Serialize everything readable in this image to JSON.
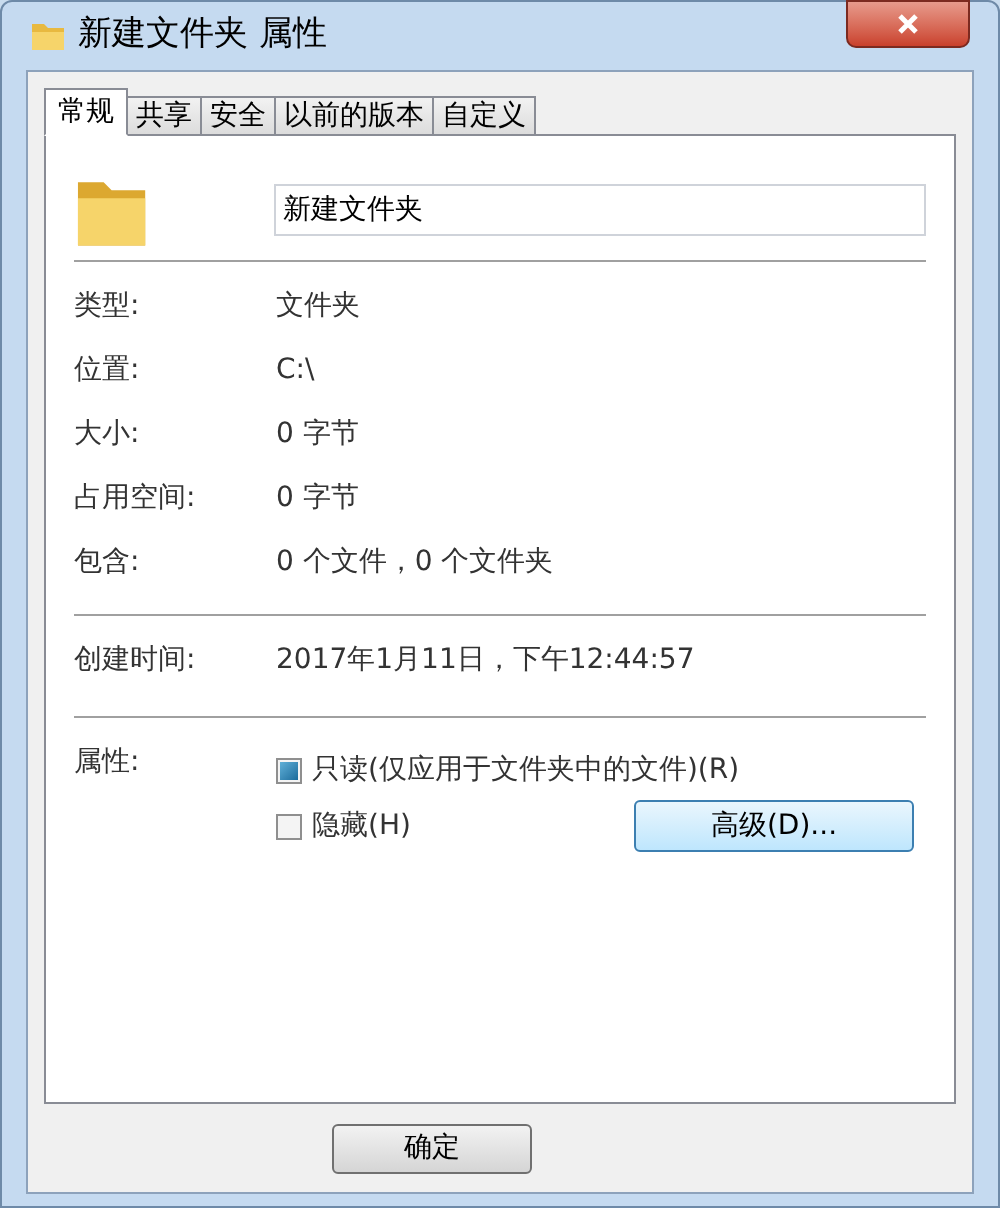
{
  "window": {
    "title": "新建文件夹 属性"
  },
  "tabs": [
    {
      "label": "常规",
      "selected": true
    },
    {
      "label": "共享",
      "selected": false
    },
    {
      "label": "安全",
      "selected": false
    },
    {
      "label": "以前的版本",
      "selected": false
    },
    {
      "label": "自定义",
      "selected": false
    }
  ],
  "name_field": {
    "value": "新建文件夹"
  },
  "property_groups": [
    [
      {
        "label": "类型:",
        "value": "文件夹"
      },
      {
        "label": "位置:",
        "value": "C:\\"
      },
      {
        "label": "大小:",
        "value": "0 字节"
      },
      {
        "label": "占用空间:",
        "value": "0 字节"
      },
      {
        "label": "包含:",
        "value": "0 个文件，0 个文件夹"
      }
    ],
    [
      {
        "label": "创建时间:",
        "value": "2017年1月11日，下午12:44:57"
      }
    ]
  ],
  "attributes": {
    "label": "属性:",
    "checkboxes": [
      {
        "label": "只读(仅应用于文件夹中的文件)(R)",
        "checked": true
      },
      {
        "label": "隐藏(H)",
        "checked": false
      }
    ],
    "advanced_button": "高级(D)..."
  },
  "buttons": [
    "确定"
  ]
}
